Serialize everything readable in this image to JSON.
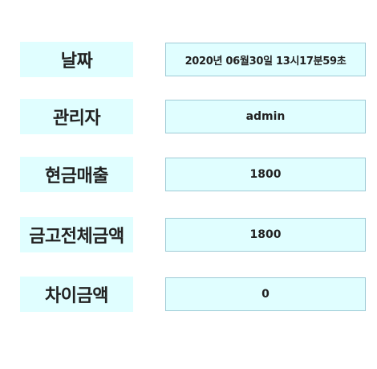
{
  "fields": [
    {
      "label": "날짜",
      "value": "2020년 06월30일 13시17분59초"
    },
    {
      "label": "관리자",
      "value": "admin"
    },
    {
      "label": "현금매출",
      "value": "1800"
    },
    {
      "label": "금고전체금액",
      "value": "1800"
    },
    {
      "label": "차이금액",
      "value": "0"
    }
  ],
  "colors": {
    "box_background": "#e0feff",
    "value_border": "#9fcbd6",
    "text": "#222222"
  }
}
